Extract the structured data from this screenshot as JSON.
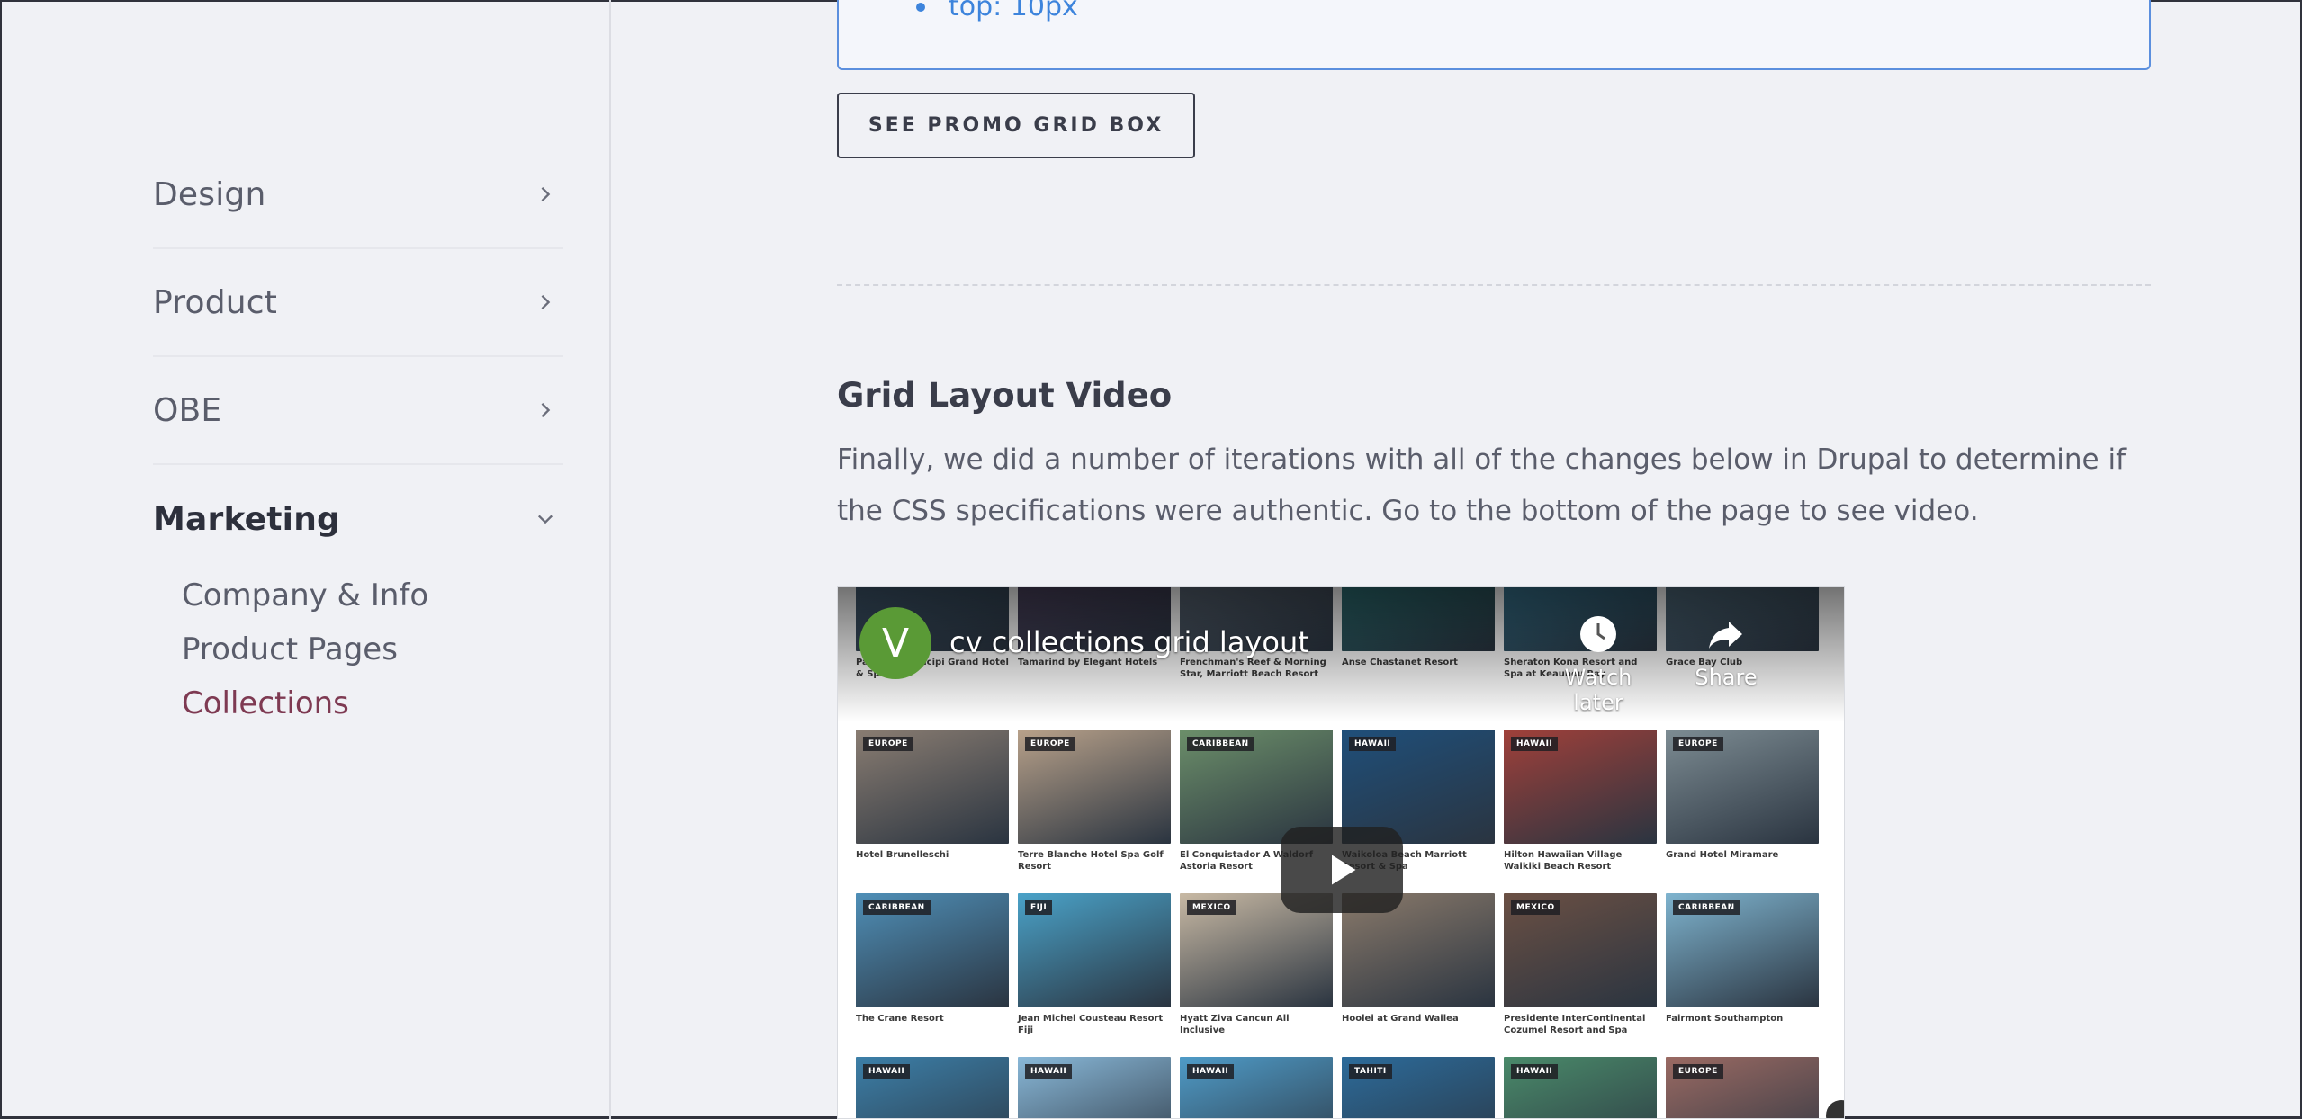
{
  "sidebar": {
    "items": [
      {
        "label": "Design",
        "expanded": false
      },
      {
        "label": "Product",
        "expanded": false
      },
      {
        "label": "OBE",
        "expanded": false
      },
      {
        "label": "Marketing",
        "expanded": true
      }
    ],
    "subitems": [
      {
        "label": "Company & Info"
      },
      {
        "label": "Product Pages"
      },
      {
        "label": "Collections",
        "current": true
      }
    ]
  },
  "main": {
    "code_line": "top: 10px",
    "promo_button_label": "SEE PROMO GRID BOX",
    "section_title": "Grid Layout Video",
    "section_body": "Finally, we did a number of iterations with all of the changes below in Drupal to determine if the CSS specifications were authentic. Go to the bottom of the page to see video."
  },
  "video": {
    "channel_initial": "V",
    "title": "cv collections grid layout",
    "watch_later_label": "Watch later",
    "share_label": "Share",
    "rows": [
      [
        {
          "tag": "",
          "name": "Parco dei Principi Grand Hotel & Spa",
          "color": "#4b6b86"
        },
        {
          "tag": "",
          "name": "Tamarind by Elegant Hotels",
          "color": "#5b4a6e"
        },
        {
          "tag": "",
          "name": "Frenchman's Reef & Morning Star, Marriott Beach Resort",
          "color": "#6d7b8b"
        },
        {
          "tag": "",
          "name": "Anse Chastanet Resort",
          "color": "#2f8c8e"
        },
        {
          "tag": "",
          "name": "Sheraton Kona Resort and Spa at Keauhou Bay",
          "color": "#3e93b5"
        },
        {
          "tag": "",
          "name": "Grace Bay Club",
          "color": "#5e8094"
        }
      ],
      [
        {
          "tag": "EUROPE",
          "name": "Hotel Brunelleschi",
          "color": "#8a7d72"
        },
        {
          "tag": "EUROPE",
          "name": "Terre Blanche Hotel Spa Golf Resort",
          "color": "#b8a18a"
        },
        {
          "tag": "CARIBBEAN",
          "name": "El Conquistador A Waldorf Astoria Resort",
          "color": "#6c8f6a"
        },
        {
          "tag": "HAWAII",
          "name": "Waikoloa Beach Marriott Resort & Spa",
          "color": "#1f4f7a"
        },
        {
          "tag": "HAWAII",
          "name": "Hilton Hawaiian Village Waikiki Beach Resort",
          "color": "#a0403a"
        },
        {
          "tag": "EUROPE",
          "name": "Grand Hotel Miramare",
          "color": "#7d8c93"
        }
      ],
      [
        {
          "tag": "CARIBBEAN",
          "name": "The Crane Resort",
          "color": "#4f8fb7"
        },
        {
          "tag": "FIJI",
          "name": "Jean Michel Cousteau Resort Fiji",
          "color": "#4aa2c8"
        },
        {
          "tag": "MEXICO",
          "name": "Hyatt Ziva Cancun All Inclusive",
          "color": "#c8b9a4"
        },
        {
          "tag": "",
          "name": "Hoolei at Grand Wailea",
          "color": "#8a7a6b"
        },
        {
          "tag": "MEXICO",
          "name": "Presidente InterContinental Cozumel Resort and Spa",
          "color": "#6b5044"
        },
        {
          "tag": "CARIBBEAN",
          "name": "Fairmont Southampton",
          "color": "#7fb4cf"
        }
      ],
      [
        {
          "tag": "HAWAII",
          "name": "",
          "color": "#3c7fa8"
        },
        {
          "tag": "HAWAII",
          "name": "",
          "color": "#89b8d8"
        },
        {
          "tag": "HAWAII",
          "name": "",
          "color": "#4f9bc7"
        },
        {
          "tag": "TAHITI",
          "name": "",
          "color": "#2c6b9a"
        },
        {
          "tag": "HAWAII",
          "name": "",
          "color": "#4a8a6a"
        },
        {
          "tag": "EUROPE",
          "name": "",
          "color": "#9a6a63"
        }
      ]
    ]
  }
}
